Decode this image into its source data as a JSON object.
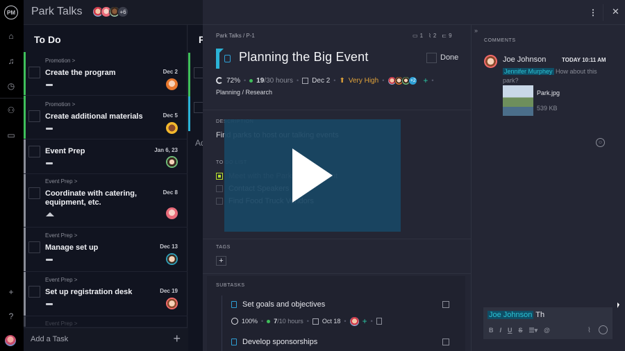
{
  "app": {
    "logo": "PM",
    "project_title": "Park Talks",
    "team_extra": "+6"
  },
  "nav_rail": {
    "items": [
      "home-icon",
      "notifications-icon",
      "time-icon",
      "people-icon",
      "portfolio-icon"
    ],
    "bottom": [
      "add-icon",
      "help-icon",
      "user-avatar"
    ]
  },
  "board": {
    "column_title": "To Do",
    "next_column_initial": "P",
    "next_column_add": "Ad",
    "cards": [
      {
        "crumb": "Promotion >",
        "title": "Create the program",
        "due": "Dec 2",
        "priority": "medium",
        "stripe": "#3fbf5a"
      },
      {
        "crumb": "Promotion >",
        "title": "Create additional materials",
        "due": "Dec 5",
        "priority": "medium",
        "stripe": "#3fbf5a"
      },
      {
        "crumb": "",
        "title": "Event Prep",
        "due": "Jan 6, 23",
        "priority": "medium",
        "stripe": "#8a8d98"
      },
      {
        "crumb": "Event Prep >",
        "title": "Coordinate with catering, equipment, etc.",
        "due": "Dec 8",
        "priority": "high",
        "stripe": "#8a8d98"
      },
      {
        "crumb": "Event Prep >",
        "title": "Manage set up",
        "due": "Dec 13",
        "priority": "medium",
        "stripe": "#8a8d98"
      },
      {
        "crumb": "Event Prep >",
        "title": "Set up registration desk",
        "due": "Dec 19",
        "priority": "medium",
        "stripe": "#8a8d98"
      },
      {
        "crumb": "Event Prep >",
        "title": "",
        "due": "",
        "priority": "",
        "stripe": "#8a8d98"
      }
    ],
    "add_task_label": "Add a Task"
  },
  "detail": {
    "breadcrumb": "Park Talks  /  P-1",
    "comments_count": "1",
    "attachments_count": "2",
    "subtasks_count": "9",
    "title": "Planning the Big Event",
    "done_label": "Done",
    "progress": "72%",
    "hours_done": "19",
    "hours_total": "/30 hours",
    "due": "Dec 2",
    "priority": "Very High",
    "assignees_extra": "+2",
    "path": "Planning / Research",
    "description_label": "DESCRIPTION",
    "description": "Find parks to host our talking events",
    "todo_label": "TO DO LIST",
    "todos": [
      {
        "text": "Meet with the Parks Department",
        "done": true
      },
      {
        "text": "Contact Speakers",
        "done": false
      },
      {
        "text": "Find Food Truck Vendors",
        "done": false
      }
    ],
    "tags_label": "TAGS",
    "subtasks_label": "SUBTASKS",
    "subtasks": [
      {
        "title": "Set goals and objectives",
        "progress": "100%",
        "hours_done": "7",
        "hours_total": "/10 hours",
        "due": "Oct 18"
      },
      {
        "title": "Develop sponsorships"
      }
    ]
  },
  "comments": {
    "label": "COMMENTS",
    "items": [
      {
        "author": "Joe Johnson",
        "time": "TODAY 10:11 AM",
        "mention": "Jennifer Murphey",
        "text": " How about this park?",
        "attachment": {
          "name": "Park.jpg",
          "size": "539 KB"
        }
      }
    ],
    "composer": {
      "mention": "Joe Johnson",
      "typed": " Th",
      "toolbar": [
        "B",
        "I",
        "U",
        "S",
        "list",
        "@"
      ]
    }
  },
  "video": {
    "state": "paused"
  }
}
